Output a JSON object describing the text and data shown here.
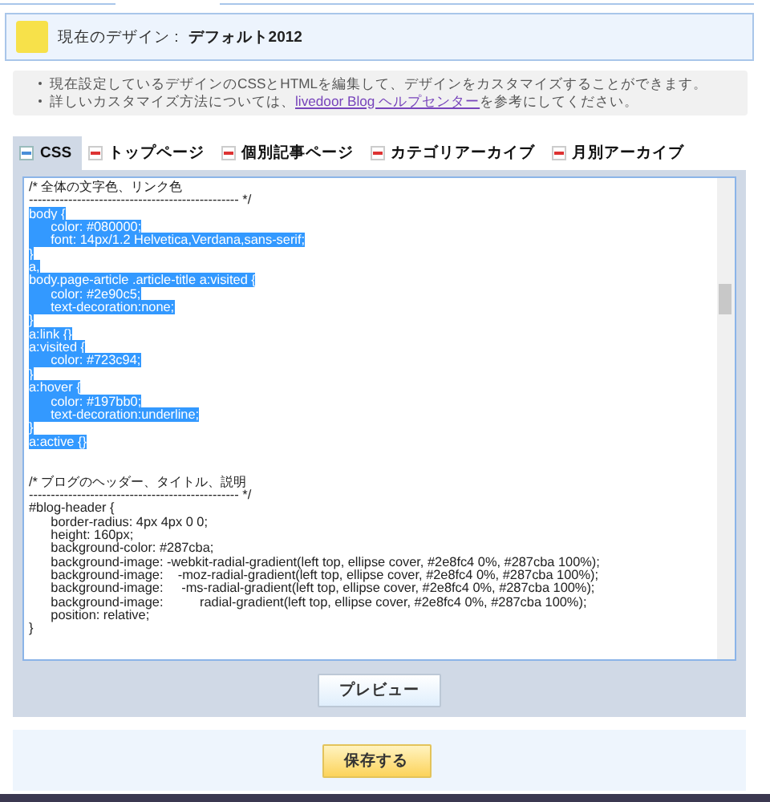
{
  "design": {
    "label": "現在のデザイン : ",
    "name": "デフォルト2012"
  },
  "notes": [
    {
      "text": "現在設定しているデザインのCSSとHTMLを編集して、デザインをカスタマイズすることができます。"
    },
    {
      "text": "詳しいカスタマイズ方法については、",
      "link": "livedoor Blog ヘルプセンター",
      "after": "を参考にしてください。"
    }
  ],
  "tabs": [
    {
      "label": "CSS",
      "kind": "css",
      "selected": true
    },
    {
      "label": "トップページ",
      "kind": "html",
      "selected": false
    },
    {
      "label": "個別記事ページ",
      "kind": "html",
      "selected": false
    },
    {
      "label": "カテゴリアーカイブ",
      "kind": "html",
      "selected": false
    },
    {
      "label": "月別アーカイブ",
      "kind": "html",
      "selected": false
    }
  ],
  "editor": {
    "sections": [
      {
        "lines": [
          {
            "text": "/* 全体の文字色、リンク色",
            "selected": false
          },
          {
            "text": "------------------------------------------------ */",
            "selected": false
          },
          {
            "text": "body {",
            "selected": true
          },
          {
            "text": "\tcolor: #080000;",
            "selected": true
          },
          {
            "text": "\tfont: 14px/1.2 Helvetica,Verdana,sans-serif;",
            "selected": true
          },
          {
            "text": "}",
            "selected": true
          },
          {
            "text": "a,",
            "selected": true
          },
          {
            "text": "body.page-article .article-title a:visited {",
            "selected": true
          },
          {
            "text": "\tcolor: #2e90c5;",
            "selected": true
          },
          {
            "text": "\ttext-decoration:none;",
            "selected": true
          },
          {
            "text": "}",
            "selected": true
          },
          {
            "text": "a:link {}",
            "selected": true
          },
          {
            "text": "a:visited {",
            "selected": true
          },
          {
            "text": "\tcolor: #723c94;",
            "selected": true
          },
          {
            "text": "}",
            "selected": true
          },
          {
            "text": "a:hover {",
            "selected": true
          },
          {
            "text": "\tcolor: #197bb0;",
            "selected": true
          },
          {
            "text": "\ttext-decoration:underline;",
            "selected": true
          },
          {
            "text": "}",
            "selected": true
          },
          {
            "text": "a:active {}",
            "selected": true
          }
        ]
      },
      {
        "lines": [
          {
            "text": "/* ブログのヘッダー、タイトル、説明",
            "selected": false
          },
          {
            "text": "------------------------------------------------ */",
            "selected": false
          },
          {
            "text": "#blog-header {",
            "selected": false
          },
          {
            "text": "\tborder-radius: 4px 4px 0 0;",
            "selected": false
          },
          {
            "text": "\theight: 160px;",
            "selected": false
          },
          {
            "text": "\tbackground-color: #287cba;",
            "selected": false
          },
          {
            "text": "\tbackground-image: -webkit-radial-gradient(left top, ellipse cover, #2e8fc4 0%, #287cba 100%);",
            "selected": false
          },
          {
            "text": "\tbackground-image:    -moz-radial-gradient(left top, ellipse cover, #2e8fc4 0%, #287cba 100%);",
            "selected": false
          },
          {
            "text": "\tbackground-image:     -ms-radial-gradient(left top, ellipse cover, #2e8fc4 0%, #287cba 100%);",
            "selected": false
          },
          {
            "text": "\tbackground-image:          radial-gradient(left top, ellipse cover, #2e8fc4 0%, #287cba 100%);",
            "selected": false
          },
          {
            "text": "\tposition: relative;",
            "selected": false
          },
          {
            "text": "}",
            "selected": false
          }
        ]
      }
    ]
  },
  "preview_button": "プレビュー",
  "save_button": "保存する"
}
